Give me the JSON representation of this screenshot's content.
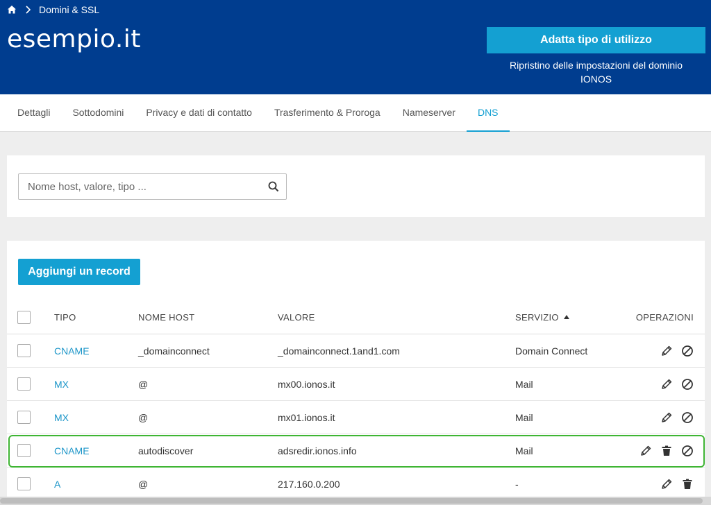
{
  "breadcrumb": {
    "home_icon": "home-icon",
    "separator_icon": "chevron-right-icon",
    "current": "Domini & SSL"
  },
  "header": {
    "domain": "esempio.it",
    "adapt_button": "Adatta tipo di utilizzo",
    "reset_link_line1": "Ripristino delle impostazioni del dominio",
    "reset_link_line2": "IONOS"
  },
  "tabs": [
    {
      "label": "Dettagli"
    },
    {
      "label": "Sottodomini"
    },
    {
      "label": "Privacy e dati di contatto"
    },
    {
      "label": "Trasferimento & Proroga"
    },
    {
      "label": "Nameserver"
    },
    {
      "label": "DNS",
      "active": true
    }
  ],
  "search": {
    "placeholder": "Nome host, valore, tipo ...",
    "icon": "search-icon"
  },
  "table": {
    "add_button": "Aggiungi un record",
    "columns": {
      "type": "TIPO",
      "host": "NOME HOST",
      "value": "VALORE",
      "service": "SERVIZIO",
      "operations": "OPERAZIONI"
    },
    "sort": {
      "column": "service",
      "direction": "ascending"
    },
    "rows": [
      {
        "type": "CNAME",
        "host": "_domainconnect",
        "value": "_domainconnect.1and1.com",
        "service": "Domain Connect",
        "ops": [
          "edit",
          "disable"
        ]
      },
      {
        "type": "MX",
        "host": "@",
        "value": "mx00.ionos.it",
        "service": "Mail",
        "ops": [
          "edit",
          "disable"
        ]
      },
      {
        "type": "MX",
        "host": "@",
        "value": "mx01.ionos.it",
        "service": "Mail",
        "ops": [
          "edit",
          "disable"
        ]
      },
      {
        "type": "CNAME",
        "host": "autodiscover",
        "value": "adsredir.ionos.info",
        "service": "Mail",
        "ops": [
          "edit",
          "delete",
          "disable"
        ],
        "highlighted": true
      },
      {
        "type": "A",
        "host": "@",
        "value": "217.160.0.200",
        "service": "-",
        "ops": [
          "edit",
          "delete"
        ]
      }
    ]
  },
  "colors": {
    "header_bg": "#003d8f",
    "accent": "#14a0d2",
    "highlight": "#3fb534"
  }
}
